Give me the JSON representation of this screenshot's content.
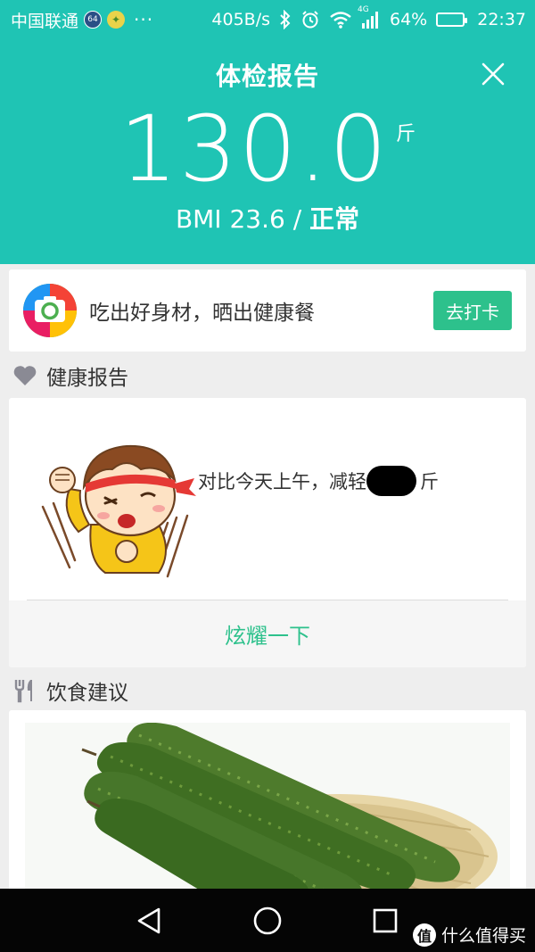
{
  "status_bar": {
    "carrier": "中国联通",
    "badge": "64",
    "net_speed": "405B/s",
    "network_type": "4G",
    "battery": "64%",
    "battery_level": 0.64,
    "time": "22:37"
  },
  "header": {
    "title": "体检报告",
    "weight": "130.0",
    "unit": "斤",
    "bmi_label": "BMI 23.6 /",
    "bmi_status": "正常",
    "bg_color": "#1fc4b4"
  },
  "promo": {
    "text": "吃出好身材，晒出健康餐",
    "button": "去打卡",
    "button_color": "#2dc18c"
  },
  "health_report": {
    "section_title": "健康报告",
    "compare_text": "对比今天上午，减轻",
    "unit": "斤",
    "share_button": "炫耀一下"
  },
  "diet": {
    "section_title": "饮食建议"
  },
  "watermark": {
    "logo": "值",
    "text": "什么值得买"
  }
}
